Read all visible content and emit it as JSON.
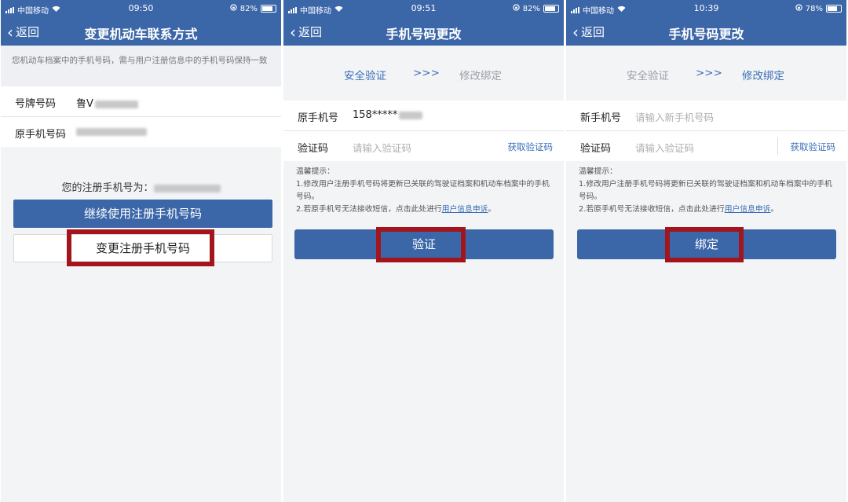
{
  "status": {
    "carrier": "中国移动",
    "screens": [
      {
        "time": "09:50",
        "battery": "82%"
      },
      {
        "time": "09:51",
        "battery": "82%"
      },
      {
        "time": "10:39",
        "battery": "78%"
      }
    ]
  },
  "screen1": {
    "back_label": "返回",
    "title": "变更机动车联系方式",
    "notice": "您机动车档案中的手机号码，需与用户注册信息中的手机号码保持一致",
    "plate_label": "号牌号码",
    "plate_value": "鲁V",
    "orig_phone_label": "原手机号码",
    "reg_phone_text": "您的注册手机号为：",
    "continue_button": "继续使用注册手机号码",
    "change_button": "变更注册手机号码"
  },
  "screen2": {
    "back_label": "返回",
    "title": "手机号码更改",
    "step1": "安全验证",
    "arrow": ">>>",
    "step2": "修改绑定",
    "phone_label": "原手机号",
    "phone_value": "158*****",
    "code_label": "验证码",
    "code_placeholder": "请输入验证码",
    "get_code": "获取验证码",
    "tips_title": "温馨提示：",
    "tip1": "1.修改用户注册手机号码将更新已关联的驾驶证档案和机动车档案中的手机号码。",
    "tip2_prefix": "2.若原手机号无法接收短信，点击此处进行",
    "tip2_link": "用户信息申诉",
    "tip2_suffix": "。",
    "button": "验证"
  },
  "screen3": {
    "back_label": "返回",
    "title": "手机号码更改",
    "step1": "安全验证",
    "arrow": ">>>",
    "step2": "修改绑定",
    "phone_label": "新手机号",
    "phone_placeholder": "请输入新手机号码",
    "code_label": "验证码",
    "code_placeholder": "请输入验证码",
    "get_code": "获取验证码",
    "tips_title": "温馨提示：",
    "tip1": "1.修改用户注册手机号码将更新已关联的驾驶证档案和机动车档案中的手机号码。",
    "tip2_prefix": "2.若原手机号无法接收短信，点击此处进行",
    "tip2_link": "用户信息申诉",
    "tip2_suffix": "。",
    "button": "绑定"
  },
  "colors": {
    "primary": "#3b66a8",
    "link": "#3b6fb7",
    "highlight": "#a3151c",
    "background": "#f3f4f6"
  }
}
